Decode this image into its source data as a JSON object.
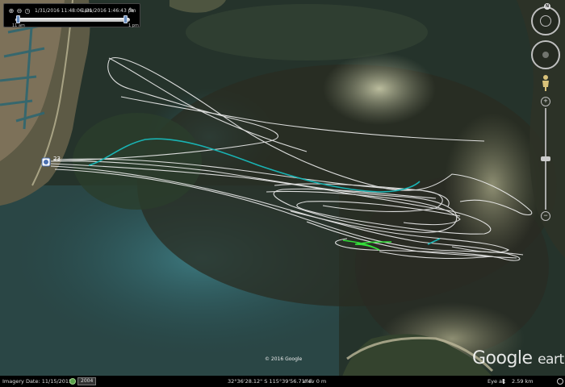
{
  "app": {
    "name": "Google Earth"
  },
  "time_slider": {
    "start_date": "1/31/2016 11:48:06 am",
    "end_date": "1/31/2016 1:46:43 pm",
    "start_label": "11 am",
    "end_label": "1 pm",
    "icons": [
      "zoom-in-icon",
      "zoom-out-icon",
      "clock-icon",
      "settings-wrench-icon"
    ]
  },
  "map": {
    "point_label": "23",
    "copyright": "© 2016 Google",
    "watermark_word1": "Google",
    "watermark_word2": "earth",
    "colors": {
      "track": "#f2f2f2",
      "track_teal": "#19b3b3",
      "track_green": "#34e03a"
    }
  },
  "status_bar": {
    "imagery_date": "Imagery Date: 11/15/2015",
    "historical_year": "2004",
    "coordinates": "32°36'28.12\" S  115°39'56.71\" E",
    "elevation": "elev    0 m",
    "eye_alt_label": "Eye alt",
    "eye_alt_value": "2.59 km"
  },
  "nav": {
    "north_label": "N"
  }
}
